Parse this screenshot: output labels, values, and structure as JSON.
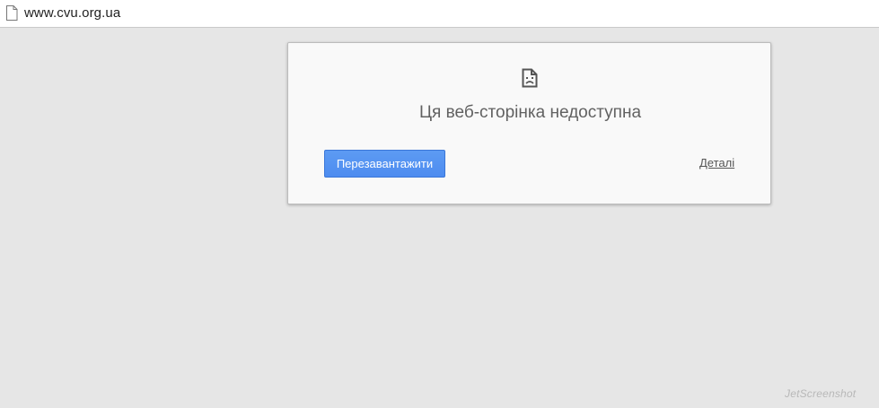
{
  "addressbar": {
    "icon": "page-icon",
    "url": "www.cvu.org.ua"
  },
  "error": {
    "icon": "sad-page-icon",
    "title": "Ця веб-сторінка недоступна",
    "reload_label": "Перезавантажити",
    "details_label": "Деталі"
  },
  "watermark": {
    "text": "JetScreenshot"
  },
  "colors": {
    "background": "#e6e6e6",
    "card": "#f9f9f9",
    "accent": "#4d8cf0",
    "title": "#616161"
  }
}
